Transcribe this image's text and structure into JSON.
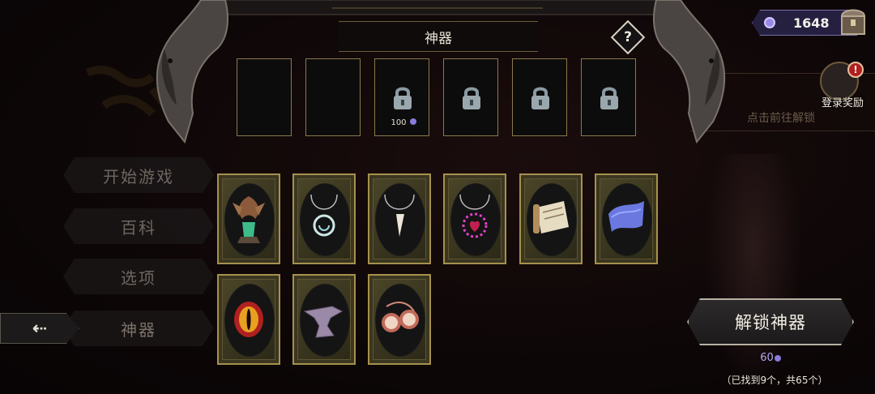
{
  "panel": {
    "title": "神器",
    "help_label": "?"
  },
  "slots": [
    {
      "locked": false,
      "cost": ""
    },
    {
      "locked": false,
      "cost": ""
    },
    {
      "locked": true,
      "cost": "100"
    },
    {
      "locked": true,
      "cost": ""
    },
    {
      "locked": true,
      "cost": ""
    },
    {
      "locked": true,
      "cost": ""
    }
  ],
  "menu": {
    "items": [
      {
        "label": "开始游戏"
      },
      {
        "label": "百科"
      },
      {
        "label": "选项"
      },
      {
        "label": "神器"
      }
    ],
    "back_label": "⇠"
  },
  "artifacts": [
    {
      "icon": "dragon-statue-icon"
    },
    {
      "icon": "spiral-pendant-icon"
    },
    {
      "icon": "fang-necklace-icon"
    },
    {
      "icon": "thorn-heart-necklace-icon"
    },
    {
      "icon": "scroll-icon"
    },
    {
      "icon": "blue-cloth-icon"
    },
    {
      "icon": "eye-icon"
    },
    {
      "icon": "anvil-icon"
    },
    {
      "icon": "goggles-icon"
    }
  ],
  "currency": {
    "amount": "1648",
    "icon": "gem-icon",
    "color": "#9b88e6"
  },
  "login_reward": {
    "label": "登录奖励",
    "badge": "!"
  },
  "background": {
    "banner_text": "点击前往解锁"
  },
  "unlock": {
    "label": "解锁神器",
    "cost": "60",
    "found_text": "（已找到9个，共65个）"
  }
}
